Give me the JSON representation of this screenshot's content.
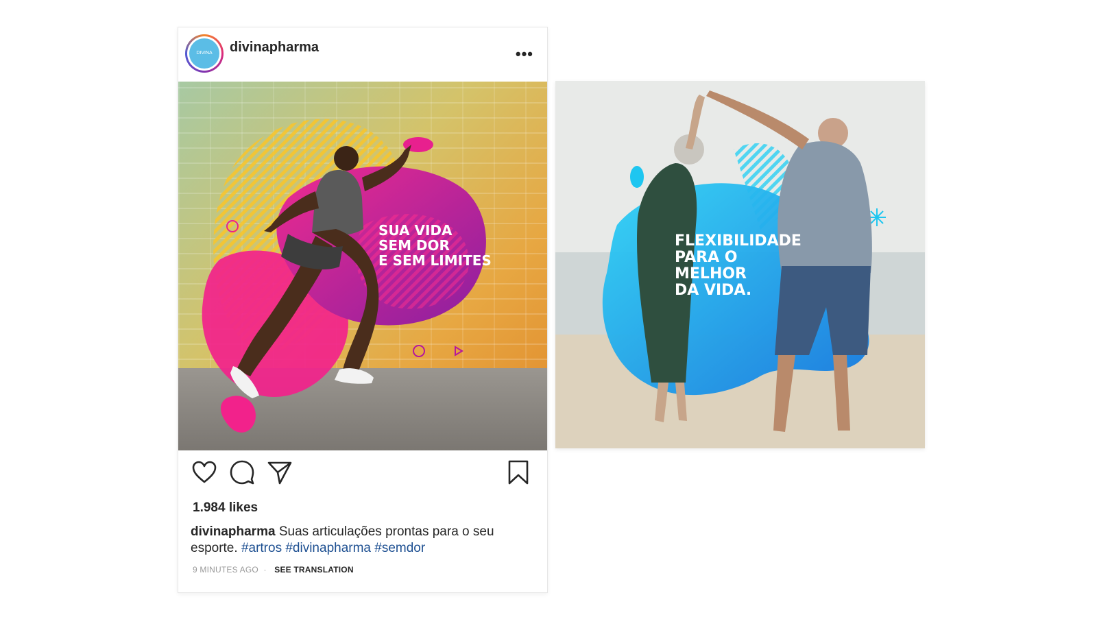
{
  "post": {
    "username": "divinapharma",
    "avatar_text": "DIVINA",
    "more_icon": "ellipsis-icon",
    "image": {
      "headline_lines": [
        "SUA VIDA",
        "SEM DOR",
        "E SEM LIMITES"
      ]
    },
    "actions": {
      "like_icon": "heart-icon",
      "comment_icon": "comment-icon",
      "share_icon": "paper-plane-icon",
      "save_icon": "bookmark-icon"
    },
    "likes": "1.984 likes",
    "caption": {
      "user": "divinapharma",
      "text": "Suas articulações prontas para o seu esporte.",
      "hashtags": [
        "#artros",
        "#divinapharma",
        "#semdor"
      ]
    },
    "time_ago": "9 MINUTES AGO",
    "separator": "·",
    "see_translation": "SEE TRANSLATION"
  },
  "second_post": {
    "headline_lines": [
      "FLEXIBILIDADE",
      "PARA O",
      "MELHOR",
      "DA VIDA."
    ]
  },
  "colors": {
    "pink": "#e8208e",
    "magenta": "#b5179e",
    "yellow": "#f5c43a",
    "cyan": "#1ec6f0",
    "blue": "#1a6fd8",
    "hashtag": "#1d4f91"
  }
}
